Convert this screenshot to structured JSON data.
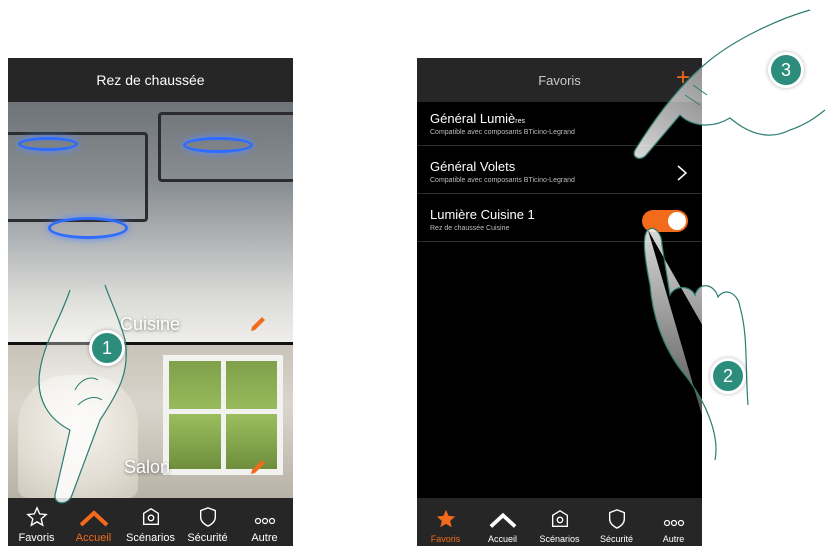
{
  "phone1": {
    "header_title": "Rez de chaussée",
    "rooms": [
      {
        "label": "Cuisine"
      },
      {
        "label": "Salon"
      }
    ],
    "nav": [
      {
        "label": "Favoris",
        "icon": "star-outline-icon",
        "active": false
      },
      {
        "label": "Accueil",
        "icon": "home-roof-icon",
        "active": true
      },
      {
        "label": "Scénarios",
        "icon": "scenario-gear-icon",
        "active": false
      },
      {
        "label": "Sécurité",
        "icon": "shield-icon",
        "active": false
      },
      {
        "label": "Autre",
        "icon": "more-dots-icon",
        "active": false
      }
    ]
  },
  "phone2": {
    "header_title": "Favoris",
    "add_icon": "plus-icon",
    "items": [
      {
        "title_main": "Général Lumiè",
        "title_small": "res",
        "subtitle": "Compatible avec composants BTicino-Legrand"
      },
      {
        "title": "Général Volets",
        "subtitle": "Compatible avec composants BTicino-Legrand"
      },
      {
        "title": "Lumière Cuisine 1",
        "subtitle": "Rez de chaussée Cuisine",
        "toggle_on": true
      }
    ],
    "nav": [
      {
        "label": "Favoris",
        "icon": "star-filled-icon",
        "active": true
      },
      {
        "label": "Accueil",
        "icon": "home-roof-icon",
        "active": false
      },
      {
        "label": "Scénarios",
        "icon": "scenario-gear-icon",
        "active": false
      },
      {
        "label": "Sécurité",
        "icon": "shield-icon",
        "active": false
      },
      {
        "label": "Autre",
        "icon": "more-dots-icon",
        "active": false
      }
    ]
  },
  "steps": [
    {
      "number": "1"
    },
    {
      "number": "2"
    },
    {
      "number": "3"
    }
  ],
  "colors": {
    "accent": "#f26a1b",
    "badge": "#2d8d7d",
    "bar": "#262626"
  }
}
